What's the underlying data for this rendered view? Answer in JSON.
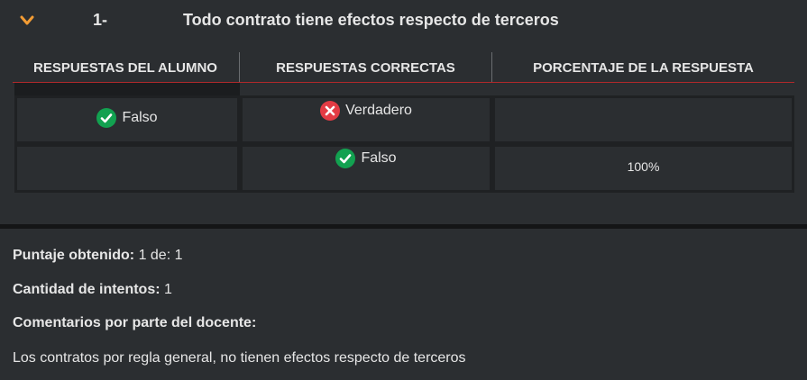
{
  "question": {
    "number": "1-",
    "title": "Todo contrato tiene efectos respecto de terceros",
    "chevron_icon": "chevron-down-icon",
    "accent_color": "#f39c34"
  },
  "table": {
    "headers": [
      "RESPUESTAS DEL ALUMNO",
      "RESPUESTAS CORRECTAS",
      "PORCENTAJE DE LA RESPUESTA"
    ],
    "rows": [
      {
        "student_answer": {
          "text": "Falso",
          "status": "correct",
          "icon": "check-circle-icon"
        },
        "correct_answer": {
          "text": "Verdadero",
          "status": "incorrect",
          "icon": "x-circle-icon"
        },
        "percentage": ""
      },
      {
        "student_answer": {
          "text": "",
          "status": "",
          "icon": ""
        },
        "correct_answer": {
          "text": "Falso",
          "status": "correct",
          "icon": "check-circle-icon"
        },
        "percentage": "100%"
      }
    ],
    "colors": {
      "correct": "#12a150",
      "incorrect": "#e33b44",
      "header_rule": "#b0292b"
    }
  },
  "summary": {
    "score_label": "Puntaje obtenido:",
    "score_value": "1 de: 1",
    "attempts_label": "Cantidad de intentos:",
    "attempts_value": "1",
    "comments_label": "Comentarios por parte del docente:",
    "comment_text": "Los contratos por regla general, no tienen efectos respecto de terceros"
  }
}
